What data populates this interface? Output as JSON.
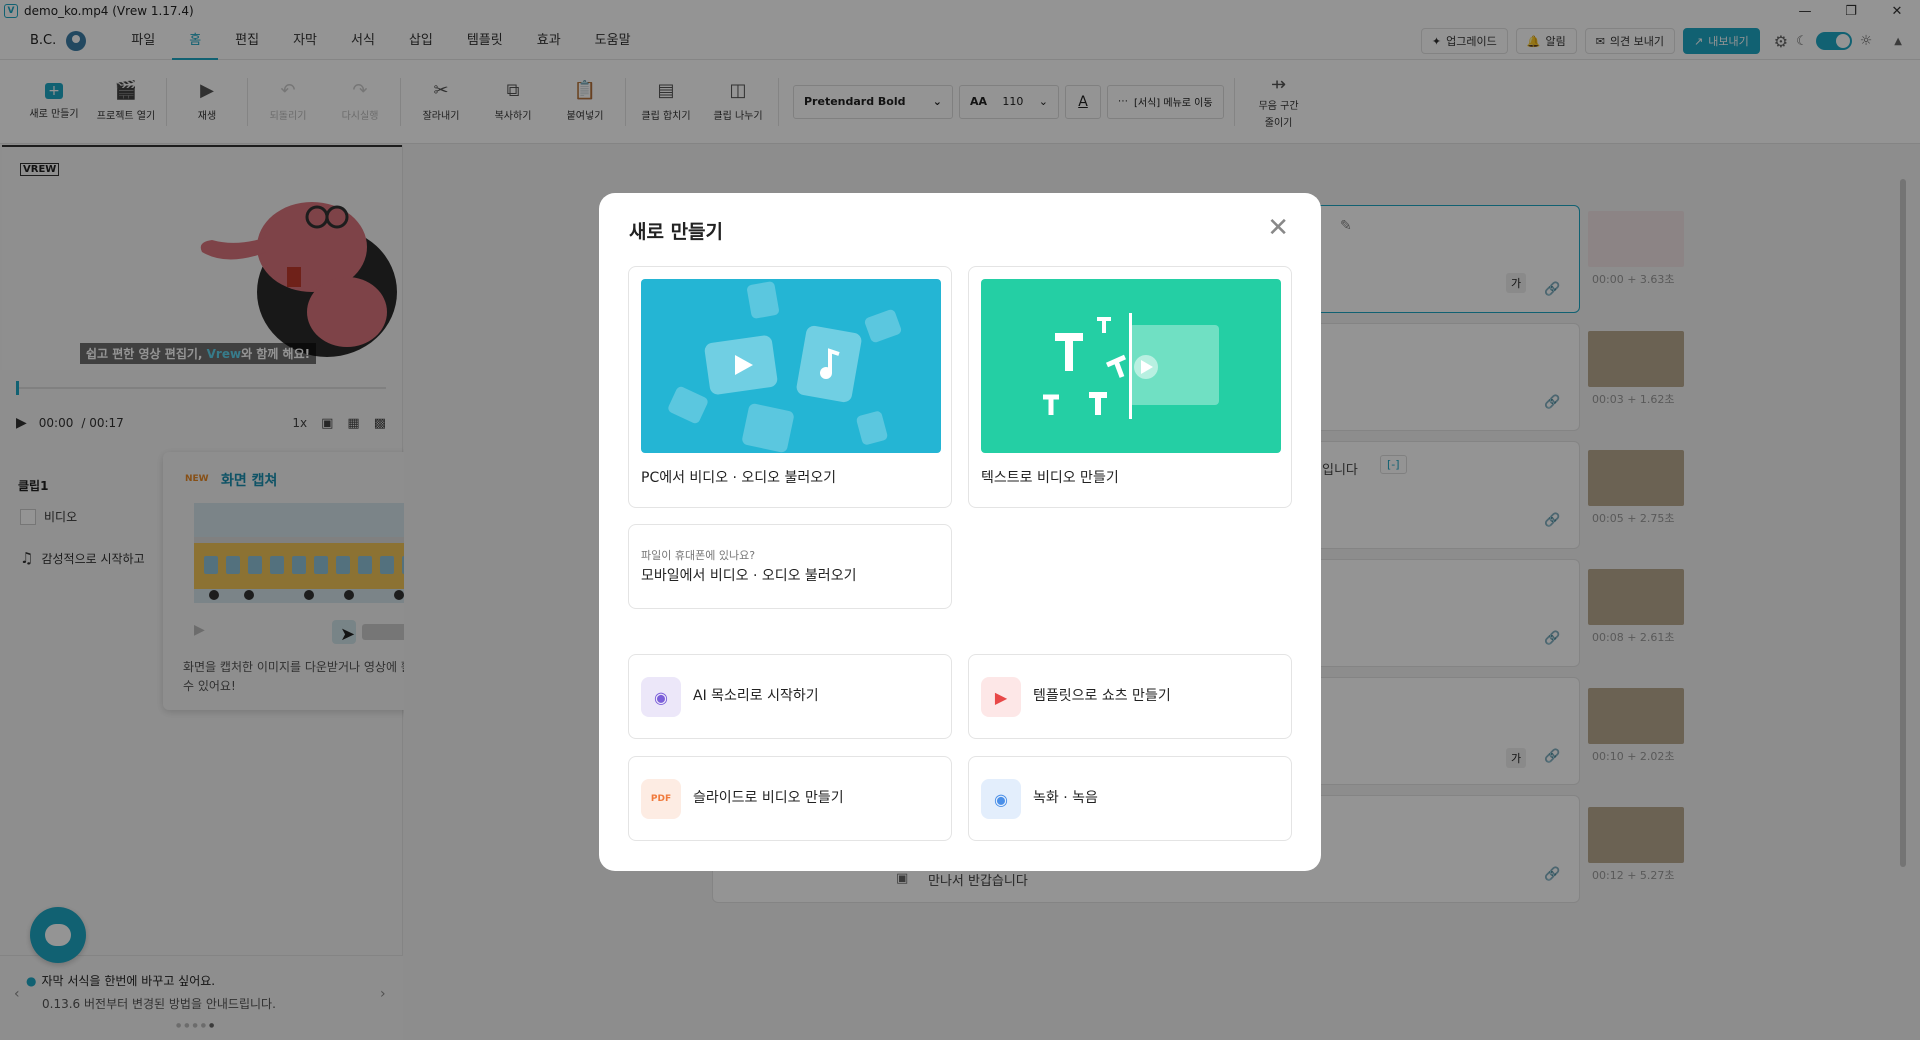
{
  "window": {
    "title": "demo_ko.mp4 (Vrew 1.17.4)",
    "app_icon": "V"
  },
  "menubar": {
    "user": "B.C.",
    "items": [
      "파일",
      "홈",
      "편집",
      "자막",
      "서식",
      "삽입",
      "템플릿",
      "효과",
      "도움말"
    ],
    "active": "홈",
    "right": {
      "upgrade": "업그레이드",
      "notify": "알림",
      "feedback": "의견 보내기",
      "export": "내보내기"
    }
  },
  "toolbar": {
    "new": "새로 만들기",
    "open_project": "프로젝트 열기",
    "play": "재생",
    "undo": "되돌리기",
    "redo": "다시실행",
    "cut": "잘라내기",
    "copy": "복사하기",
    "paste": "붙여넣기",
    "merge_clip": "클립 합치기",
    "split_clip": "클립 나누기",
    "font": "Pretendard Bold",
    "font_size": "110",
    "color_glyph": "A",
    "more": "[서식] 메뉴로 이동",
    "silence_1": "무음 구간",
    "silence_2": "줄이기"
  },
  "preview": {
    "logo": "VREW",
    "caption_pre": "쉽고 편한 영상 편집기, ",
    "caption_brand": "Vrew",
    "caption_post": "와 함께 해요!",
    "current_time": "00:00",
    "total_time": "/ 00:17",
    "speed": "1x"
  },
  "clip_panel": {
    "title": "클립1",
    "video": "비디오",
    "audio": "감성적으로 시작하고"
  },
  "popover": {
    "badge": "NEW",
    "title": "화면 캡쳐",
    "desc": "화면을 캡처한 이미지를 다운받거나 영상에 활용할 수 있어요!"
  },
  "tip": {
    "line1": "자막 서식을 한번에 바꾸고 싶어요.",
    "line2": "0.13.6 버전부터 변경된 방법을 안내드립니다."
  },
  "timeline": {
    "rows": [
      {
        "time": "00:00 + 3.63초"
      },
      {
        "time": "00:03 + 1.62초"
      },
      {
        "time": "00:05 + 2.75초",
        "text": "입니다",
        "bracket": "[-]"
      },
      {
        "time": "00:08 + 2.61초"
      },
      {
        "time": "00:10 + 2.02초"
      },
      {
        "time": "00:12 + 5.27초",
        "text": "만나서 반갑습니다"
      }
    ],
    "ga": "가"
  },
  "modal": {
    "title": "새로 만들기",
    "pc_import": "PC에서 비디오 · 오디오 불러오기",
    "text_to_video": "텍스트로 비디오 만들기",
    "mobile_hint": "파일이 휴대폰에 있나요?",
    "mobile_import": "모바일에서 비디오 · 오디오 불러오기",
    "ai_voice": "AI 목소리로 시작하기",
    "template_shorts": "템플릿으로 쇼츠 만들기",
    "slides": "슬라이드로 비디오 만들기",
    "record": "녹화 · 녹음",
    "pdf_badge": "PDF"
  },
  "colors": {
    "accent": "#1ea7c4",
    "pc_card": "#24b5d4",
    "text_card": "#24cfa4"
  }
}
